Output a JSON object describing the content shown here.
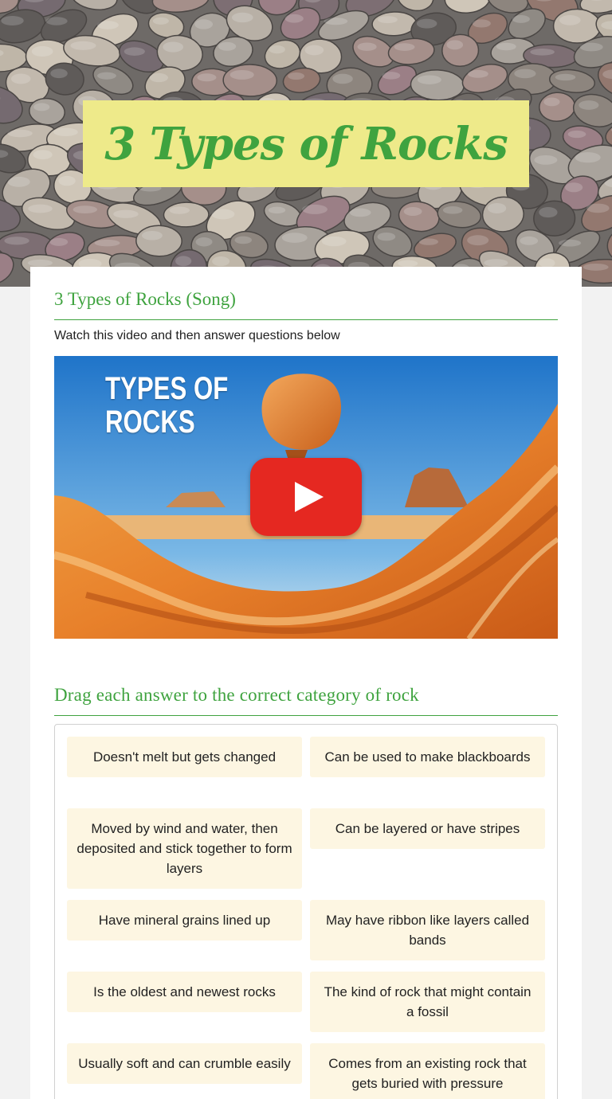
{
  "header": {
    "title": "3 Types of Rocks"
  },
  "video_section": {
    "heading": "3 Types of Rocks (Song)",
    "instruction": "Watch this video and then answer questions below",
    "thumbnail_caption_line1": "TYPES OF",
    "thumbnail_caption_line2": "ROCKS"
  },
  "drag_section": {
    "heading": "Drag each answer to the correct category of rock",
    "answers": [
      "Doesn't melt but gets changed",
      "Can be used to make blackboards",
      "Moved by wind and water, then deposited and stick together to form layers",
      "Can be layered or have stripes",
      "Have mineral grains lined up",
      "May have ribbon like layers called bands",
      "Is the oldest and newest rocks",
      "The kind of rock that might contain a fossil",
      "Usually soft and can crumble easily",
      "Comes from an existing rock that gets buried with pressure"
    ]
  },
  "colors": {
    "accent_green": "#3fa33f",
    "title_box": "#eeea8a",
    "answer_chip": "#fdf6e2",
    "play_red": "#e52821"
  }
}
